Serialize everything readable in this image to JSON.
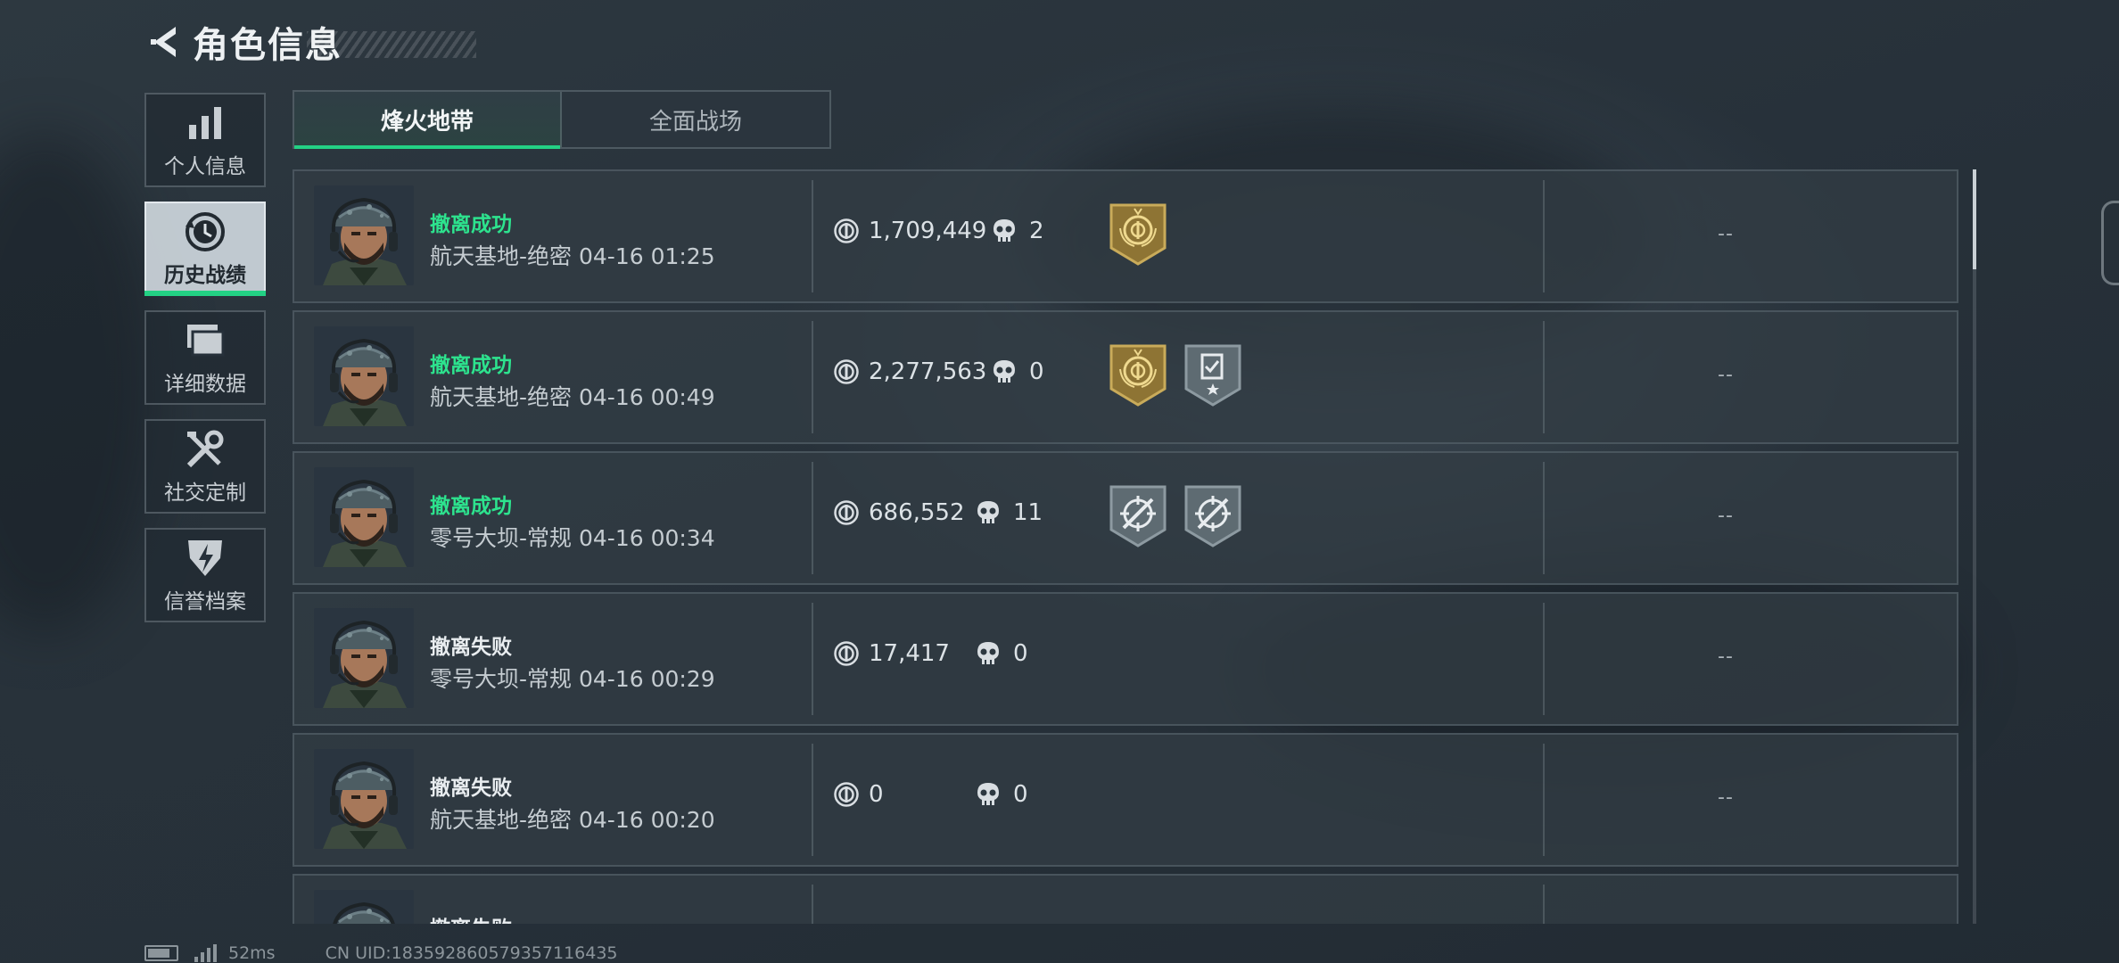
{
  "header": {
    "title": "角色信息",
    "back_icon": "back-arrow-icon"
  },
  "sidebar": {
    "items": [
      {
        "label": "个人信息",
        "icon": "bar-chart-icon",
        "active": false
      },
      {
        "label": "历史战绩",
        "icon": "clock-history-icon",
        "active": true
      },
      {
        "label": "详细数据",
        "icon": "folder-stack-icon",
        "active": false
      },
      {
        "label": "社交定制",
        "icon": "tools-icon",
        "active": false
      },
      {
        "label": "信誉档案",
        "icon": "shield-lightning-icon",
        "active": false
      }
    ]
  },
  "tabs": [
    {
      "label": "烽火地带",
      "active": true
    },
    {
      "label": "全面战场",
      "active": false
    }
  ],
  "records": [
    {
      "status": "撤离成功",
      "result": "success",
      "map": "航天基地-绝密",
      "time": "04-16 01:25",
      "value": "1,709,449",
      "kills": "2",
      "badges": [
        "gold-emblem-badge"
      ],
      "extra": "--"
    },
    {
      "status": "撤离成功",
      "result": "success",
      "map": "航天基地-绝密",
      "time": "04-16 00:49",
      "value": "2,277,563",
      "kills": "0",
      "badges": [
        "gold-emblem-badge",
        "task-complete-badge"
      ],
      "extra": "--"
    },
    {
      "status": "撤离成功",
      "result": "success",
      "map": "零号大坝-常规",
      "time": "04-16 00:34",
      "value": "686,552",
      "kills": "11",
      "badges": [
        "crosshair-badge",
        "crosshair-badge"
      ],
      "extra": "--"
    },
    {
      "status": "撤离失败",
      "result": "fail",
      "map": "零号大坝-常规",
      "time": "04-16 00:29",
      "value": "17,417",
      "kills": "0",
      "badges": [],
      "extra": "--"
    },
    {
      "status": "撤离失败",
      "result": "fail",
      "map": "航天基地-绝密",
      "time": "04-16 00:20",
      "value": "0",
      "kills": "0",
      "badges": [],
      "extra": "--"
    },
    {
      "status": "撤离失败",
      "result": "fail",
      "map": "",
      "time": "",
      "value": "",
      "kills": "",
      "badges": [],
      "extra": ""
    }
  ],
  "footer": {
    "ping": "52ms",
    "uid": "CN UID:1835928605793571164​35"
  },
  "colors": {
    "accent": "#23d184",
    "success": "#2de38e",
    "gold": "#b0913f"
  }
}
